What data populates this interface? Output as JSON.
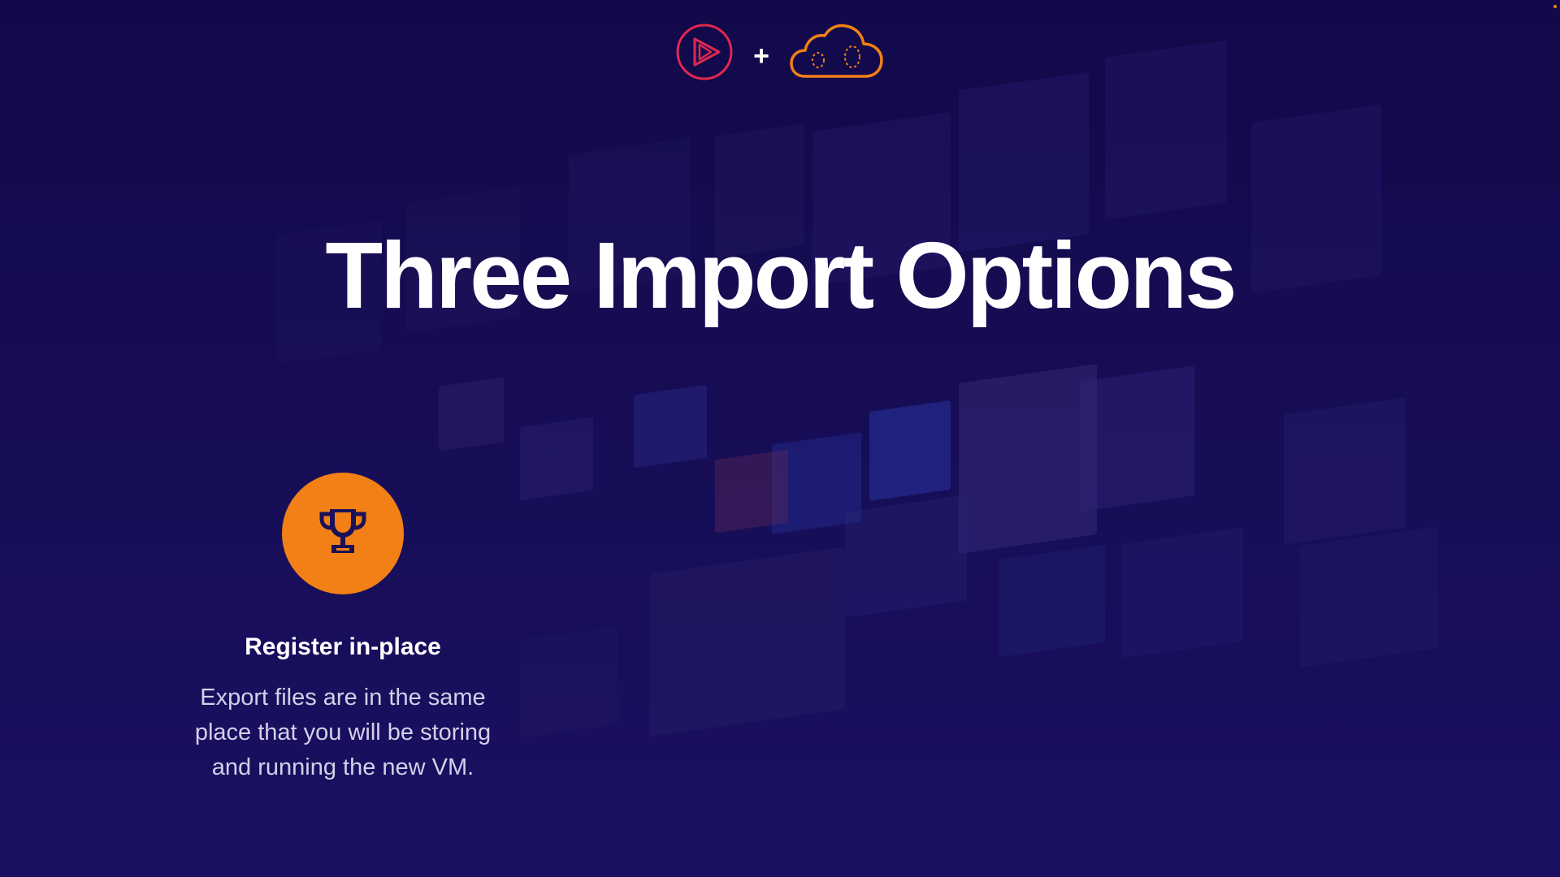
{
  "header": {
    "left_logo_icon": "play-circle-icon",
    "separator": "+",
    "right_logo_icon": "cloud-icon",
    "left_logo_color": "#e0284f",
    "right_logo_color": "#f28016"
  },
  "slide": {
    "title": "Three Import Options"
  },
  "options": [
    {
      "icon": "trophy-icon",
      "badge_color": "#f28016",
      "title": "Register in-place",
      "description": "Export files are in the same place that you will be storing and running the new VM."
    }
  ],
  "colors": {
    "background": "#160d55",
    "accent": "#f28016",
    "text": "#ffffff"
  }
}
